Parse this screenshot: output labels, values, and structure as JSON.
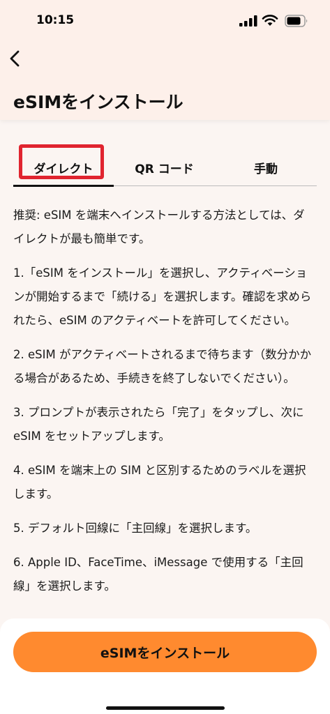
{
  "status_bar": {
    "time": "10:15",
    "icons": [
      "signal-icon",
      "wifi-icon",
      "battery-icon"
    ]
  },
  "header": {
    "back_icon": "chevron-left-icon",
    "title": "eSIMをインストール"
  },
  "tabs": [
    {
      "label": "ダイレクト",
      "active": true
    },
    {
      "label": "QR コード",
      "active": false
    },
    {
      "label": "手動",
      "active": false
    }
  ],
  "content": {
    "paragraphs": [
      "推奨: eSIM を端末へインストールする方法としては、ダイレクトが最も簡単です。",
      "1.「eSIM をインストール」を選択し、アクティベーションが開始するまで「続ける」を選択します。確認を求められたら、eSIM のアクティベートを許可してください。",
      "2. eSIM がアクティベートされるまで待ちます（数分かかる場合があるため、手続きを終了しないでください）。",
      "3. プロンプトが表示されたら「完了」をタップし、次に eSIM をセットアップします。",
      "4. eSIM を端末上の SIM と区別するためのラベルを選択します。",
      "5. デフォルト回線に「主回線」を選択します。",
      "6. Apple ID、FaceTime、iMessage で使用する「主回線」を選択します。"
    ]
  },
  "footer": {
    "install_button_label": "eSIMをインストール"
  },
  "colors": {
    "accent_button": "#ff8a2f",
    "highlight_border": "#e0242f",
    "header_bg": "#fdf0ea",
    "page_bg": "#fbf5f2"
  }
}
